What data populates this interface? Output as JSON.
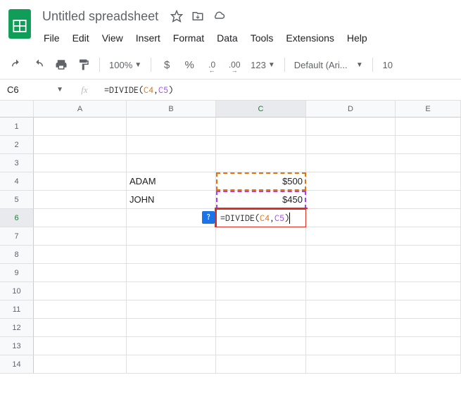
{
  "doc": {
    "title": "Untitled spreadsheet"
  },
  "menu": {
    "file": "File",
    "edit": "Edit",
    "view": "View",
    "insert": "Insert",
    "format": "Format",
    "data": "Data",
    "tools": "Tools",
    "extensions": "Extensions",
    "help": "Help"
  },
  "toolbar": {
    "zoom": "100%",
    "currency": "$",
    "percent": "%",
    "decrease": ".0",
    "increase": ".00",
    "numfmt": "123",
    "font": "Default (Ari...",
    "font_size": "10"
  },
  "formula_bar": {
    "name_box": "C6",
    "formula": {
      "eq": "=",
      "func": "DIVIDE",
      "open": "(",
      "ref1": "C4",
      "comma": ",",
      "ref2": "C5",
      "close": ")"
    }
  },
  "columns": [
    "A",
    "B",
    "C",
    "D",
    "E"
  ],
  "rows": [
    "1",
    "2",
    "3",
    "4",
    "5",
    "6",
    "7",
    "8",
    "9",
    "10",
    "11",
    "12",
    "13",
    "14"
  ],
  "cells": {
    "B4": "ADAM",
    "C4": "$500",
    "B5": "JOHN",
    "C5": "$450",
    "C6": {
      "eq": "=",
      "func": "DIVIDE",
      "open": "(",
      "ref1": "C4",
      "comma": ",",
      "ref2": "C5",
      "close": ")"
    }
  },
  "help_badge": "?"
}
